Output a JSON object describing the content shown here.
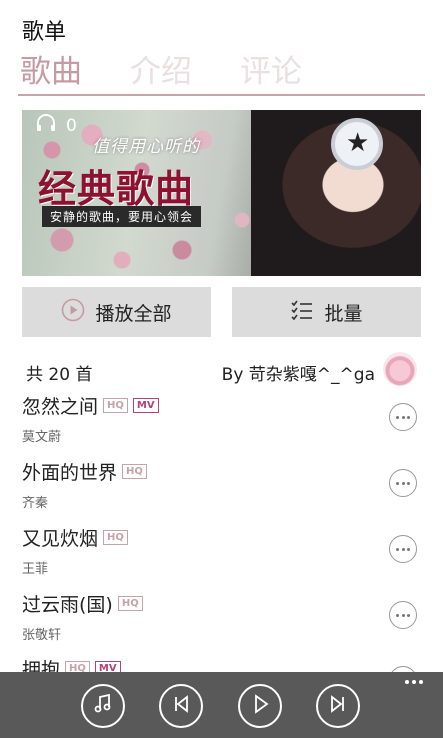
{
  "page": {
    "title": "歌单"
  },
  "tabs": [
    {
      "label": "歌曲",
      "active": true
    },
    {
      "label": "介绍",
      "active": false
    },
    {
      "label": "评论",
      "active": false
    }
  ],
  "banner": {
    "play_count": "0",
    "line1": "值得用心听的",
    "line2": "经典歌曲",
    "line3": "安静的歌曲，要用心领会",
    "icon": "headphones-icon"
  },
  "actions": {
    "play_all": "播放全部",
    "batch": "批量"
  },
  "playlist": {
    "count": "共 20 首",
    "creator": "By 苛杂紫嘎^_^ga"
  },
  "songs": [
    {
      "title": "忽然之间",
      "artist": "莫文蔚",
      "hq": "HQ",
      "mv": "MV"
    },
    {
      "title": "外面的世界",
      "artist": "齐秦",
      "hq": "HQ"
    },
    {
      "title": "又见炊烟",
      "artist": "王菲",
      "hq": "HQ"
    },
    {
      "title": "过云雨(国)",
      "artist": "张敬轩",
      "hq": "HQ"
    },
    {
      "title": "拥抱",
      "artist": "",
      "hq": "HQ",
      "mv": "MV"
    }
  ],
  "colors": {
    "accent": "#c69aa5",
    "tab_inactive": "#eadfe1",
    "appbar": "#595959",
    "mv": "#b5417a"
  },
  "appbar": {
    "icons": [
      "music-note-icon",
      "previous-icon",
      "play-icon",
      "next-icon",
      "more-icon"
    ]
  }
}
